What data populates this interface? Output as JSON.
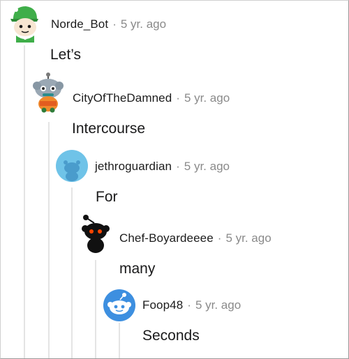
{
  "comments": [
    {
      "username": "Norde_Bot",
      "separator": "·",
      "time": "5 yr. ago",
      "text": "Let’s",
      "avatar": "green-hat-snoo-avatar"
    },
    {
      "username": "CityOfTheDamned",
      "separator": "·",
      "time": "5 yr. ago",
      "text": "Intercourse",
      "avatar": "robot-snoo-avatar"
    },
    {
      "username": "jethroguardian",
      "separator": "·",
      "time": "5 yr. ago",
      "text": "For",
      "avatar": "default-blue-avatar"
    },
    {
      "username": "Chef-Boyardeeee",
      "separator": "·",
      "time": "5 yr. ago",
      "text": "many",
      "avatar": "black-snoo-avatar"
    },
    {
      "username": "Foop48",
      "separator": "·",
      "time": "5 yr. ago",
      "text": "Seconds",
      "avatar": "blue-snoo-avatar"
    }
  ],
  "colors": {
    "thread_line": "#e4e4e4",
    "meta_text": "#8a8a8a",
    "default_avatar_blue": "#6fc3e8",
    "snoo_blue": "#3d8fe0"
  }
}
